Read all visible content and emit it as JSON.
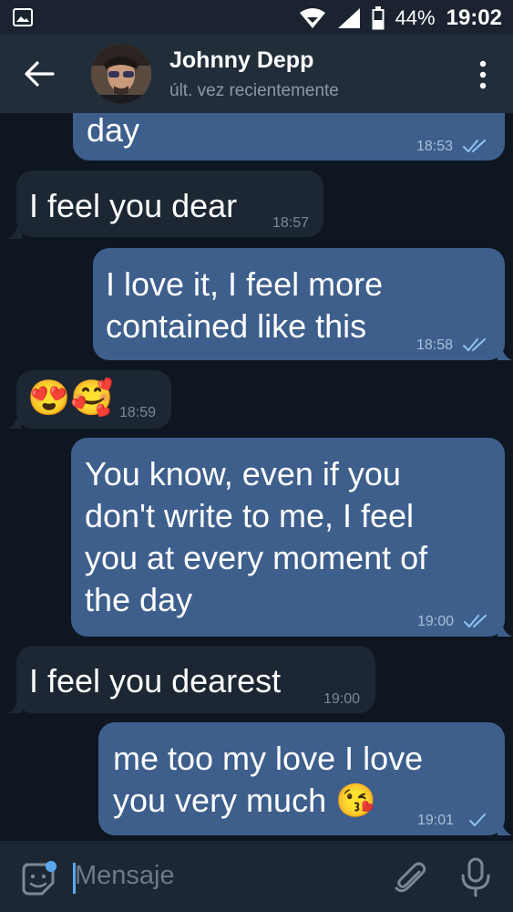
{
  "status_bar": {
    "battery": "44%",
    "time": "19:02",
    "icons": [
      "image-icon",
      "wifi-icon",
      "signal-icon",
      "battery-icon"
    ]
  },
  "header": {
    "name": "Johnny Depp",
    "status": "últ. vez recientemente",
    "icons": [
      "back-arrow-icon",
      "avatar",
      "more-vertical-icon"
    ]
  },
  "messages": [
    {
      "direction": "out",
      "text": "day",
      "time": "18:53",
      "read": true
    },
    {
      "direction": "in",
      "text": "I feel you dear",
      "time": "18:57"
    },
    {
      "direction": "out",
      "text": "I love it, I feel more\ncontained like this",
      "time": "18:58",
      "read": true
    },
    {
      "direction": "in",
      "text": "😍🥰",
      "time": "18:59"
    },
    {
      "direction": "out",
      "text": "You know, even if you\ndon't write to me, I feel\nyou at every moment of\nthe day",
      "time": "19:00",
      "read": true
    },
    {
      "direction": "in",
      "text": "I feel you dearest",
      "time": "19:00"
    },
    {
      "direction": "out",
      "text": "me too my love I love\nyou very much 😘",
      "time": "19:01",
      "read": false
    }
  ],
  "input": {
    "placeholder": "Mensaje",
    "icons": [
      "sticker-icon",
      "attach-icon",
      "microphone-icon"
    ]
  },
  "colors": {
    "background": "#0e1621",
    "header": "#222d3a",
    "outgoing_bubble": "#3e5f8c",
    "incoming_bubble": "#1c2733",
    "accent": "#5aa9f0"
  }
}
